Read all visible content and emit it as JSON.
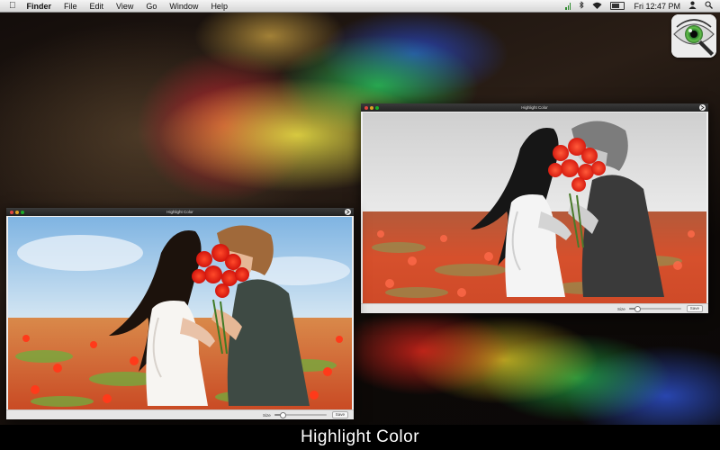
{
  "menubar": {
    "app": "Finder",
    "items": [
      "File",
      "Edit",
      "View",
      "Go",
      "Window",
      "Help"
    ],
    "clock": "Fri 12:47 PM"
  },
  "windows": {
    "back": {
      "title": "Highlight Color",
      "size_label": "Size",
      "save_label": "Save",
      "size_value": 0.15,
      "photo_mode": "grayscale-with-color-highlight"
    },
    "front": {
      "title": "Highlight Color",
      "size_label": "Size",
      "save_label": "Save",
      "size_value": 0.15,
      "photo_mode": "full-color"
    }
  },
  "caption": "Highlight Color",
  "icons": {
    "apple": "apple-logo-icon",
    "app": "highlight-color-eye-icon",
    "status": [
      "bars-icon",
      "bluetooth-icon",
      "wifi-icon",
      "battery-icon",
      "user-icon",
      "spotlight-icon"
    ]
  },
  "colors": {
    "menubar": "#e6e6e6",
    "titlebar": "#2a2a2a",
    "caption_bg": "#000000",
    "caption_text": "#ffffff",
    "rose_red": "#e8261c"
  }
}
